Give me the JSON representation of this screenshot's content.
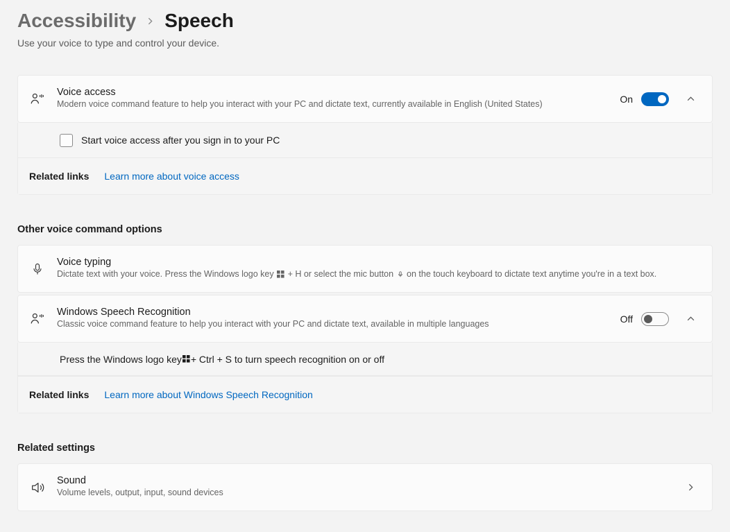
{
  "breadcrumb": {
    "parent": "Accessibility",
    "current": "Speech"
  },
  "page_description": "Use your voice to type and control your device.",
  "voice_access": {
    "title": "Voice access",
    "subtitle": "Modern voice command feature to help you interact with your PC and dictate text, currently available in English (United States)",
    "toggle_state": "On",
    "checkbox_label": "Start voice access after you sign in to your PC",
    "related_label": "Related links",
    "learn_more": "Learn more about voice access"
  },
  "other_section": "Other voice command options",
  "voice_typing": {
    "title": "Voice typing",
    "desc_prefix": "Dictate text with your voice. Press the Windows logo key ",
    "desc_mid": " + H or select the mic button ",
    "desc_suffix": " on the touch keyboard to dictate text anytime you're in a text box."
  },
  "wsr": {
    "title": "Windows Speech Recognition",
    "subtitle": "Classic voice command feature to help you interact with your PC and dictate text, available in multiple languages",
    "toggle_state": "Off",
    "hint_prefix": "Press the Windows logo key ",
    "hint_suffix": " + Ctrl + S to turn speech recognition on or off",
    "related_label": "Related links",
    "learn_more": "Learn more about Windows Speech Recognition"
  },
  "related_section": "Related settings",
  "sound": {
    "title": "Sound",
    "subtitle": "Volume levels, output, input, sound devices"
  }
}
